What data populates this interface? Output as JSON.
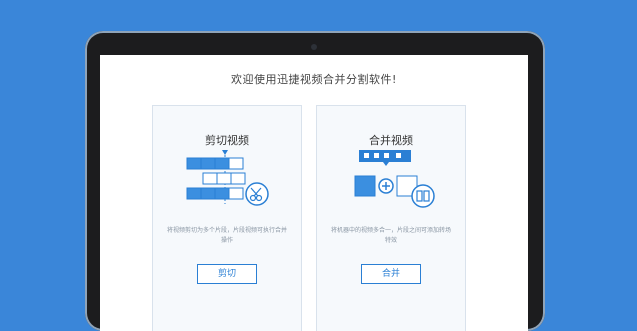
{
  "screen": {
    "welcome_text": "欢迎使用迅捷视频合并分割软件!"
  },
  "cards": [
    {
      "title": "剪切视频",
      "description": "将视频剪切为多个片段，片段视频可执行合并操作",
      "button_label": "剪切"
    },
    {
      "title": "合并视频",
      "description": "将机器中的视频多合一，片段之间可添加转场特效",
      "button_label": "合并"
    }
  ],
  "colors": {
    "background": "#3a86d9",
    "accent": "#2a7fd4",
    "bezel": "#1c1c1e"
  }
}
